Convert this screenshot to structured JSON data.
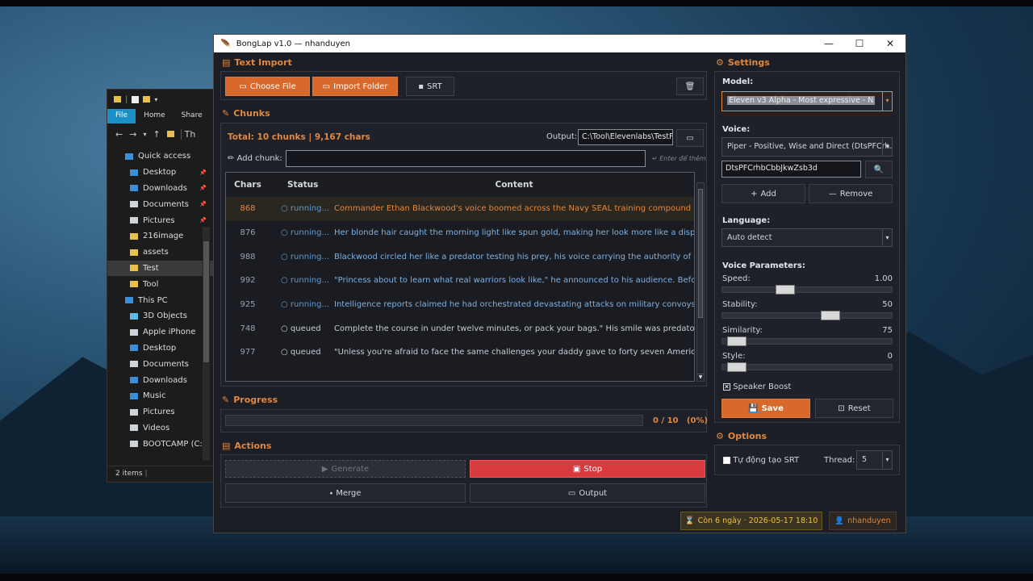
{
  "explorer": {
    "ribbon": [
      "File",
      "Home",
      "Share"
    ],
    "addr": "Th",
    "items": [
      {
        "label": "Quick access",
        "hdr": true,
        "color": "#3b8fd6"
      },
      {
        "label": "Desktop",
        "color": "#3b8fd6",
        "pin": true
      },
      {
        "label": "Downloads",
        "color": "#3b8fd6",
        "pin": true
      },
      {
        "label": "Documents",
        "color": "#cfd3da",
        "pin": true
      },
      {
        "label": "Pictures",
        "color": "#cfd3da",
        "pin": true
      },
      {
        "label": "216image",
        "color": "#e8c04a"
      },
      {
        "label": "assets",
        "color": "#e8c04a"
      },
      {
        "label": "Test",
        "color": "#e8c04a",
        "sel": true
      },
      {
        "label": "Tool",
        "color": "#e8c04a"
      },
      {
        "label": "This PC",
        "hdr": true,
        "color": "#3b8fd6"
      },
      {
        "label": "3D Objects",
        "color": "#5fb8e8"
      },
      {
        "label": "Apple iPhone",
        "color": "#cfd3da"
      },
      {
        "label": "Desktop",
        "color": "#3b8fd6"
      },
      {
        "label": "Documents",
        "color": "#cfd3da"
      },
      {
        "label": "Downloads",
        "color": "#3b8fd6"
      },
      {
        "label": "Music",
        "color": "#3b8fd6"
      },
      {
        "label": "Pictures",
        "color": "#cfd3da"
      },
      {
        "label": "Videos",
        "color": "#cfd3da"
      },
      {
        "label": "BOOTCAMP (C:)",
        "color": "#cfd3da"
      }
    ],
    "status": "2 items"
  },
  "app": {
    "title": "BongLap v1.0 — nhanduyen",
    "text_import": {
      "heading": "Text Import",
      "choose_file": "Choose File",
      "import_folder": "Import Folder",
      "srt": "SRT"
    },
    "chunks": {
      "heading": "Chunks",
      "total": "Total: 10 chunks | 9,167 chars",
      "output_label": "Output:",
      "output_value": "C:\\Tool\\Elevenlabs\\TestF",
      "add_label": "Add chunk:",
      "add_hint": "↵ Enter để thêm",
      "columns": [
        "Chars",
        "Status",
        "Content"
      ],
      "rows": [
        {
          "chars": "868",
          "status": "running...",
          "content": "Commander Ethan Blackwood's voice boomed across the Navy SEAL training compound at"
        },
        {
          "chars": "876",
          "status": "running...",
          "content": "Her blonde hair caught the morning light like spun gold, making her look more like a displa"
        },
        {
          "chars": "988",
          "status": "running...",
          "content": "Blackwood circled her like a predator testing his prey, his voice carrying the authority of son"
        },
        {
          "chars": "992",
          "status": "running...",
          "content": "\"Princess about to learn what real warriors look like,\" he announced to his audience. Before"
        },
        {
          "chars": "925",
          "status": "running...",
          "content": "Intelligence reports claimed he had orchestrated devastating attacks on military convoys in A"
        },
        {
          "chars": "748",
          "status": "queued",
          "content": "Complete the course in under twelve minutes, or pack your bags.\" His smile was predatory."
        },
        {
          "chars": "977",
          "status": "queued",
          "content": "\"Unless you're afraid to face the same challenges your daddy gave to forty seven American"
        }
      ]
    },
    "progress": {
      "heading": "Progress",
      "value": 0,
      "text": "0 / 10   (0%)"
    },
    "actions": {
      "heading": "Actions",
      "generate": "Generate",
      "stop": "Stop",
      "merge": "Merge",
      "output": "Output"
    },
    "settings": {
      "heading": "Settings",
      "model_label": "Model:",
      "model": "Eleven v3 Alpha - Most expressive - N",
      "voice_label": "Voice:",
      "voice": "Piper - Positive, Wise and Direct (DtsPFCrh...",
      "voice_id": "DtsPFCrhbCbbJkwZsb3d",
      "add": "Add",
      "remove": "Remove",
      "language_label": "Language:",
      "language": "Auto detect",
      "params_label": "Voice Parameters:",
      "params": [
        {
          "name": "Speed:",
          "value": "1.00",
          "level": 0.35
        },
        {
          "name": "Stability:",
          "value": "50",
          "level": 0.65
        },
        {
          "name": "Similarity:",
          "value": "75",
          "level": 0.03
        },
        {
          "name": "Style:",
          "value": "0",
          "level": 0.03
        }
      ],
      "speaker_boost": "Speaker Boost",
      "save": "Save",
      "reset": "Reset"
    },
    "options": {
      "heading": "Options",
      "auto_srt": "Tự động tạo SRT",
      "thread_label": "Thread:",
      "thread": "5"
    },
    "footer": {
      "license": "Còn 6 ngày · 2026-05-17 18:10",
      "user": "nhanduyen"
    }
  }
}
